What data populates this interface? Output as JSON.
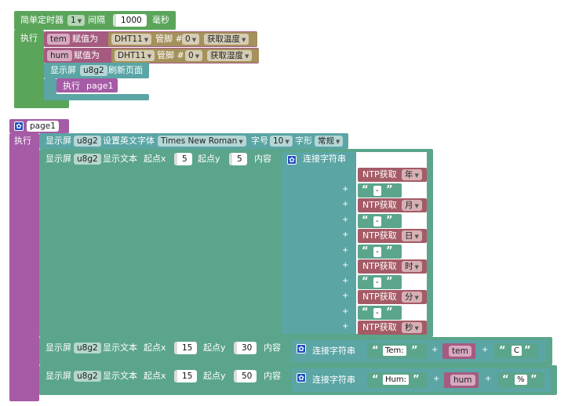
{
  "timer_block": {
    "title": "简单定时器",
    "timer_id": "1",
    "interval_label": "间隔",
    "interval_value": "1000",
    "unit": "毫秒",
    "exec_label": "执行",
    "assign_label": "赋值为",
    "tem_var": "tem",
    "hum_var": "hum",
    "sensor": "DHT11",
    "pin_label": "管脚 #",
    "pin_value": "0",
    "get_temp": "获取温度",
    "get_hum": "获取湿度",
    "display_label": "显示屏",
    "display_name": "u8g2",
    "refresh_label": "刷新页面",
    "page_exec_label": "执行",
    "page_name": "page1"
  },
  "page_block": {
    "name": "page1",
    "exec_label": "执行",
    "font_row": {
      "display_label": "显示屏",
      "display_name": "u8g2",
      "set_font_label": "设置英文字体",
      "font": "Times New Roman",
      "size_label": "字号",
      "size": "10",
      "style_label": "字形",
      "style": "常规"
    },
    "text_rows": [
      {
        "display_label": "显示屏",
        "display_name": "u8g2",
        "text_label": "显示文本",
        "x_label": "起点x",
        "x": "5",
        "y_label": "起点y",
        "y": "5",
        "content_label": "内容",
        "concat_label": "连接字符串"
      },
      {
        "display_label": "显示屏",
        "display_name": "u8g2",
        "text_label": "显示文本",
        "x_label": "起点x",
        "x": "15",
        "y_label": "起点y",
        "y": "30",
        "content_label": "内容",
        "concat_label": "连接字符串",
        "str1": "Tem:",
        "var": "tem",
        "str2": "C"
      },
      {
        "display_label": "显示屏",
        "display_name": "u8g2",
        "text_label": "显示文本",
        "x_label": "起点x",
        "x": "15",
        "y_label": "起点y",
        "y": "50",
        "content_label": "内容",
        "concat_label": "连接字符串",
        "str1": "Hum:",
        "var": "hum",
        "str2": "%"
      }
    ],
    "ntp_label": "NTP获取",
    "ntp_parts": [
      "年",
      "月",
      "日",
      "时",
      "分",
      "秒"
    ],
    "separator": "-",
    "plus": "+",
    "open_quote": "“",
    "close_quote": "”"
  },
  "colors": {
    "timer_green": "#5ba55b",
    "loop_teal": "#5ba5a5",
    "purple": "#a55ba5",
    "var_red": "#a55b80",
    "sensor_tan": "#a5915b",
    "display_teal": "#5ba5a5",
    "text_green": "#5ba58c",
    "gear_blue": "#1f4fbf"
  }
}
